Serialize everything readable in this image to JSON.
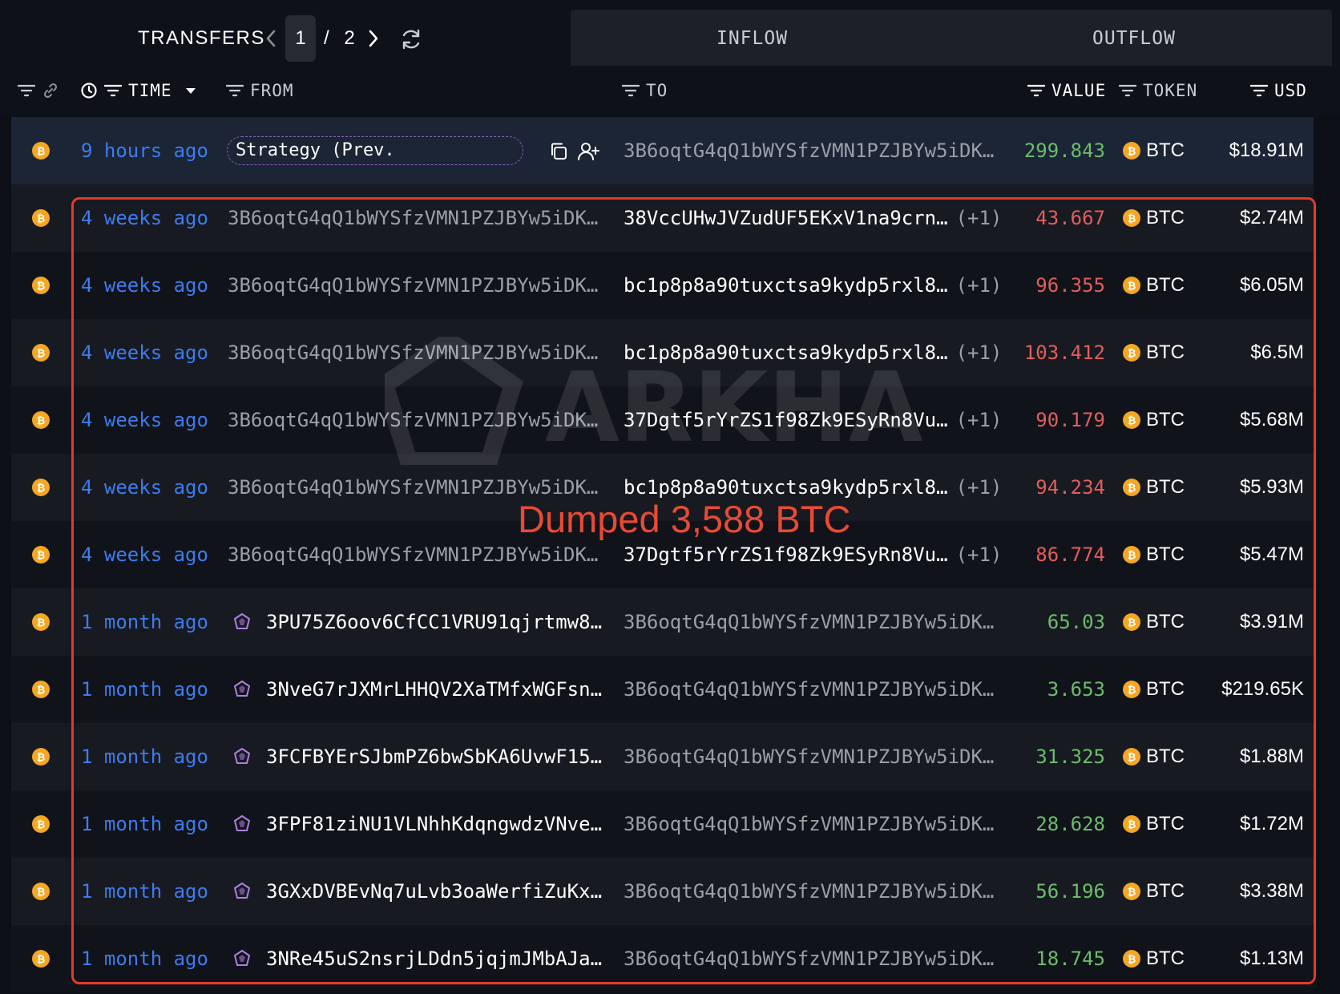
{
  "tabs": {
    "transfers": "TRANSFERS",
    "inflow": "INFLOW",
    "outflow": "OUTFLOW"
  },
  "pager": {
    "current": "1",
    "total": "/ 2"
  },
  "columns": {
    "time": "TIME",
    "from": "FROM",
    "to": "TO",
    "value": "VALUE",
    "token": "TOKEN",
    "usd": "USD"
  },
  "watermark": "ARKHAM",
  "annotation": "Dumped 3,588 BTC",
  "colors": {
    "time": "#3d7cf0",
    "inflow": "#6bbd6a",
    "outflow": "#e35d5d",
    "btc": "#f5a623",
    "annotation": "#e53a2a"
  },
  "rows": [
    {
      "time": "9 hours ago",
      "from": "Strategy (Prev. MicroStrategy",
      "from_type": "entity",
      "to": "3B6oqtG4qQ1bWYSfzVMN1PZJBYw5iDK…",
      "to_extra": "",
      "value": "299.843",
      "direction": "in",
      "token": "BTC",
      "usd": "$18.91M"
    },
    {
      "time": "4 weeks ago",
      "from": "3B6oqtG4qQ1bWYSfzVMN1PZJBYw5iDK…",
      "from_type": "plain",
      "to": "38VccUHwJVZudUF5EKxV1na9crn…",
      "to_extra": "(+1)",
      "value": "43.667",
      "direction": "out",
      "token": "BTC",
      "usd": "$2.74M"
    },
    {
      "time": "4 weeks ago",
      "from": "3B6oqtG4qQ1bWYSfzVMN1PZJBYw5iDK…",
      "from_type": "plain",
      "to": "bc1p8p8a90tuxctsa9kydp5rxl8…",
      "to_extra": "(+1)",
      "value": "96.355",
      "direction": "out",
      "token": "BTC",
      "usd": "$6.05M"
    },
    {
      "time": "4 weeks ago",
      "from": "3B6oqtG4qQ1bWYSfzVMN1PZJBYw5iDK…",
      "from_type": "plain",
      "to": "bc1p8p8a90tuxctsa9kydp5rxl8…",
      "to_extra": "(+1)",
      "value": "103.412",
      "direction": "out",
      "token": "BTC",
      "usd": "$6.5M"
    },
    {
      "time": "4 weeks ago",
      "from": "3B6oqtG4qQ1bWYSfzVMN1PZJBYw5iDK…",
      "from_type": "plain",
      "to": "37Dgtf5rYrZS1f98Zk9ESyRn8Vu…",
      "to_extra": "(+1)",
      "value": "90.179",
      "direction": "out",
      "token": "BTC",
      "usd": "$5.68M"
    },
    {
      "time": "4 weeks ago",
      "from": "3B6oqtG4qQ1bWYSfzVMN1PZJBYw5iDK…",
      "from_type": "plain",
      "to": "bc1p8p8a90tuxctsa9kydp5rxl8…",
      "to_extra": "(+1)",
      "value": "94.234",
      "direction": "out",
      "token": "BTC",
      "usd": "$5.93M"
    },
    {
      "time": "4 weeks ago",
      "from": "3B6oqtG4qQ1bWYSfzVMN1PZJBYw5iDK…",
      "from_type": "plain",
      "to": "37Dgtf5rYrZS1f98Zk9ESyRn8Vu…",
      "to_extra": "(+1)",
      "value": "86.774",
      "direction": "out",
      "token": "BTC",
      "usd": "$5.47M"
    },
    {
      "time": "1 month ago",
      "from": "3PU75Z6oov6CfCC1VRU91qjrtmw8…",
      "from_type": "tagged",
      "to": "3B6oqtG4qQ1bWYSfzVMN1PZJBYw5iDK…",
      "to_extra": "",
      "value": "65.03",
      "direction": "in",
      "token": "BTC",
      "usd": "$3.91M"
    },
    {
      "time": "1 month ago",
      "from": "3NveG7rJXMrLHHQV2XaTMfxWGFsn…",
      "from_type": "tagged",
      "to": "3B6oqtG4qQ1bWYSfzVMN1PZJBYw5iDK…",
      "to_extra": "",
      "value": "3.653",
      "direction": "in",
      "token": "BTC",
      "usd": "$219.65K"
    },
    {
      "time": "1 month ago",
      "from": "3FCFBYErSJbmPZ6bwSbKA6UvwF15…",
      "from_type": "tagged",
      "to": "3B6oqtG4qQ1bWYSfzVMN1PZJBYw5iDK…",
      "to_extra": "",
      "value": "31.325",
      "direction": "in",
      "token": "BTC",
      "usd": "$1.88M"
    },
    {
      "time": "1 month ago",
      "from": "3FPF81ziNU1VLNhhKdqngwdzVNve…",
      "from_type": "tagged",
      "to": "3B6oqtG4qQ1bWYSfzVMN1PZJBYw5iDK…",
      "to_extra": "",
      "value": "28.628",
      "direction": "in",
      "token": "BTC",
      "usd": "$1.72M"
    },
    {
      "time": "1 month ago",
      "from": "3GXxDVBEvNq7uLvb3oaWerfiZuKx…",
      "from_type": "tagged",
      "to": "3B6oqtG4qQ1bWYSfzVMN1PZJBYw5iDK…",
      "to_extra": "",
      "value": "56.196",
      "direction": "in",
      "token": "BTC",
      "usd": "$3.38M"
    },
    {
      "time": "1 month ago",
      "from": "3NRe45uS2nsrjLDdn5jqjmJMbAJa…",
      "from_type": "tagged",
      "to": "3B6oqtG4qQ1bWYSfzVMN1PZJBYw5iDK…",
      "to_extra": "",
      "value": "18.745",
      "direction": "in",
      "token": "BTC",
      "usd": "$1.13M"
    }
  ]
}
